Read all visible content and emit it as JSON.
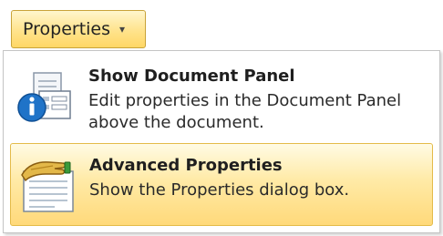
{
  "dropdown": {
    "label": "Properties",
    "arrow": "▾"
  },
  "menu": {
    "items": [
      {
        "title": "Show Document Panel",
        "description": "Edit properties in the Document Panel above the document.",
        "icon": "document-info-icon"
      },
      {
        "title": "Advanced Properties",
        "description": "Show the Properties dialog box.",
        "icon": "properties-dialog-icon",
        "highlighted": true
      }
    ]
  },
  "colors": {
    "button_border": "#c9a339",
    "highlight_fill": "#ffe38c",
    "highlight_border": "#e4bb4a",
    "info_blue": "#1f73c8",
    "hand_gold": "#d2a02d"
  }
}
